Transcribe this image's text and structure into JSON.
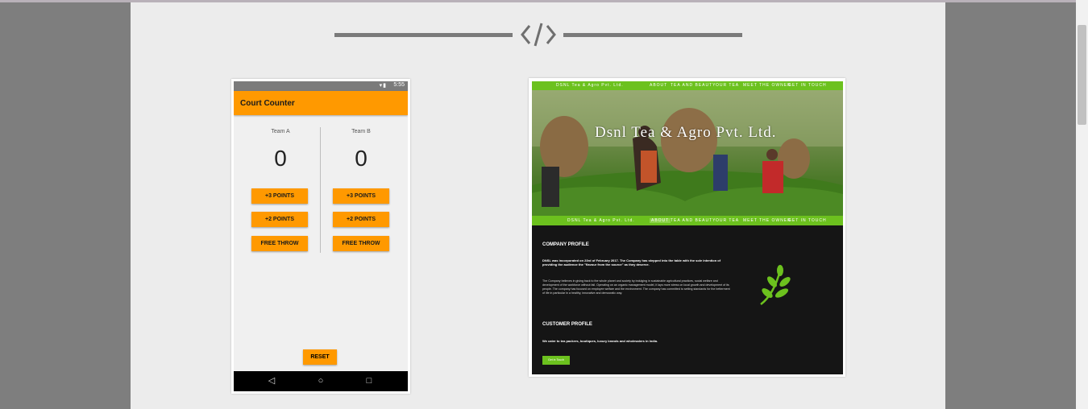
{
  "phone_app": {
    "status_time": "5:55",
    "title": "Court Counter",
    "team_a": {
      "label": "Team A",
      "score": "0",
      "buttons": [
        "+3 POINTS",
        "+2 POINTS",
        "FREE THROW"
      ]
    },
    "team_b": {
      "label": "Team B",
      "score": "0",
      "buttons": [
        "+3 POINTS",
        "+2 POINTS",
        "FREE THROW"
      ]
    },
    "reset_label": "RESET",
    "nav_icons": [
      "back-triangle-icon",
      "home-circle-icon",
      "recents-square-icon"
    ]
  },
  "website": {
    "nav_brand": "DSNL Tea & Agro Pvt. Ltd.",
    "nav_items": [
      "ABOUT",
      "TEA AND BEAUTY",
      "OUR TEA",
      "MEET THE OWNER",
      "GET IN TOUCH"
    ],
    "hero_title": "Dsnl Tea & Agro Pvt. Ltd.",
    "company_profile_heading": "COMPANY PROFILE",
    "company_profile_lead": "DNSL was incorporated on 23rd of February 2017. The Company has stepped into the table with the sole intention of providing the audience the \"flavour from the source\" as they deserve.",
    "company_profile_body": "The Company believes in giving back to the whole planet and society by indulging in sustainable agricultural practices, social welfare and development of the workforce without fail. Operating on an organic management model, it lays more stress on local growth and development of its people. The company has focused on employee welfare and the environment. The company has committed to setting standards for the betterment of life in particular in a healthy, innovative and democratic way.",
    "customer_profile_heading": "CUSTOMER PROFILE",
    "customer_profile_text": "We cater to tea packers, boutiques, luxury brands and wholesalers in India.",
    "cta_label": "Get in Touch"
  },
  "colors": {
    "accent_orange": "#ff9900",
    "accent_green": "#6cc11e",
    "panel_bg": "#ececec"
  }
}
